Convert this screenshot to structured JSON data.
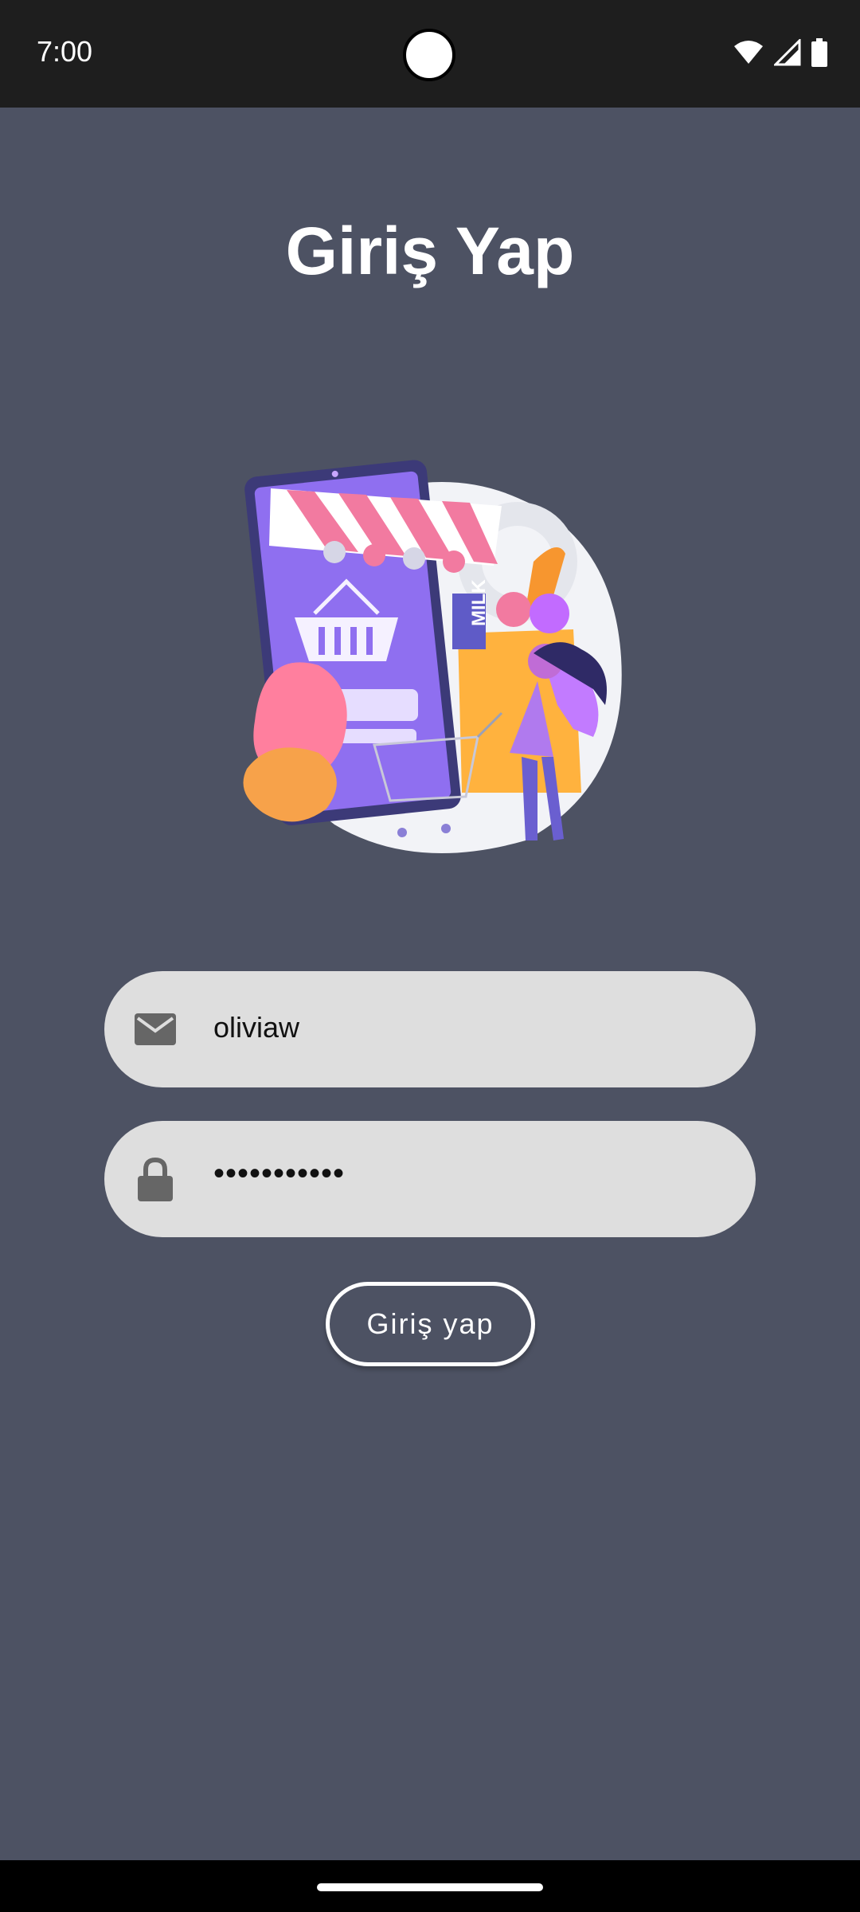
{
  "status_bar": {
    "time": "7:00"
  },
  "screen": {
    "title": "Giriş Yap",
    "email_field": {
      "value": "oliviaw",
      "icon": "envelope-icon"
    },
    "password_field": {
      "value": "•••••••••••",
      "icon": "lock-icon"
    },
    "login_button": {
      "label": "Giriş yap"
    },
    "illustration": {
      "text": "MILK"
    }
  },
  "colors": {
    "background": "#4d5263",
    "status_bar": "#1e1e1e",
    "field_bg": "#dedede",
    "icon": "#666666"
  }
}
